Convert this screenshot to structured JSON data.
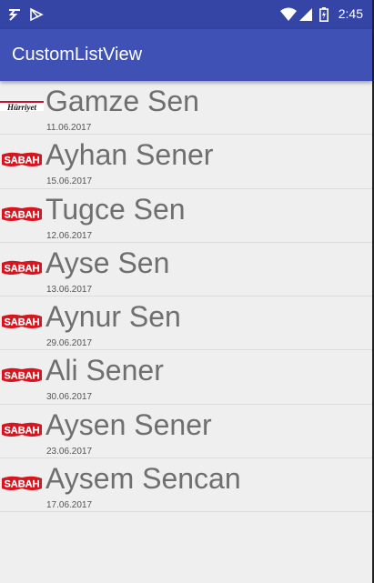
{
  "status_bar": {
    "time": "2:45",
    "icons": [
      "notification-icon",
      "play-store-icon",
      "wifi-icon",
      "signal-icon",
      "battery-icon"
    ]
  },
  "app_bar": {
    "title": "CustomListView"
  },
  "list": {
    "items": [
      {
        "name": "Gamze Sen",
        "date": "11.06.2017",
        "logo": "Hürriyet"
      },
      {
        "name": "Ayhan Sener",
        "date": "15.06.2017",
        "logo": "SABAH"
      },
      {
        "name": "Tugce Sen",
        "date": "12.06.2017",
        "logo": "SABAH"
      },
      {
        "name": "Ayse Sen",
        "date": "13.06.2017",
        "logo": "SABAH"
      },
      {
        "name": "Aynur Sen",
        "date": "29.06.2017",
        "logo": "SABAH"
      },
      {
        "name": "Ali Sener",
        "date": "30.06.2017",
        "logo": "SABAH"
      },
      {
        "name": "Aysen Sener",
        "date": "23.06.2017",
        "logo": "SABAH"
      },
      {
        "name": "Aysem Sencan",
        "date": "17.06.2017",
        "logo": "SABAH"
      }
    ]
  },
  "colors": {
    "status_bar": "#3445a6",
    "app_bar": "#3f51b5",
    "background": "#efefef",
    "name_text": "#6f6f6f",
    "sabah_red": "#d9141e"
  }
}
